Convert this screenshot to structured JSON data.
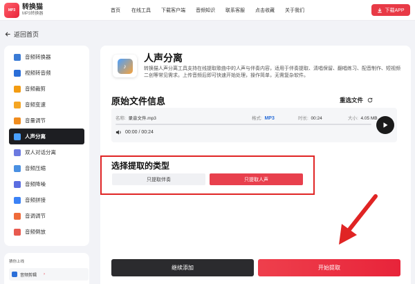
{
  "brand": {
    "logo_text": "MP3",
    "name": "转换猫",
    "subtitle": "MP3转换器"
  },
  "nav": [
    "首页",
    "在线工具",
    "下载客户端",
    "音频知识",
    "联系客服",
    "点击收藏",
    "关于我们"
  ],
  "download_label": "下载APP",
  "back_label": "返回首页",
  "sidebar": {
    "items": [
      {
        "label": "音频转换器",
        "color": "#3a7bd5"
      },
      {
        "label": "视频转音频",
        "color": "#2a6ed8"
      },
      {
        "label": "音频裁剪",
        "color": "#f39c12"
      },
      {
        "label": "音频变速",
        "color": "#f5a623"
      },
      {
        "label": "音量调节",
        "color": "#f08c1e"
      },
      {
        "label": "人声分离",
        "color": "#4aa0ff"
      },
      {
        "label": "双人对话分离",
        "color": "#6c7ae0"
      },
      {
        "label": "音频压缩",
        "color": "#4a90e2"
      },
      {
        "label": "音频降噪",
        "color": "#5b6ee1"
      },
      {
        "label": "音频拼接",
        "color": "#3b82f6"
      },
      {
        "label": "音调调节",
        "color": "#ef6b3a"
      },
      {
        "label": "音频倒放",
        "color": "#e85a4f"
      }
    ],
    "active_index": 5
  },
  "recommend": {
    "title": "猜你上线",
    "item_label": "音频剪辑",
    "arrow": "›"
  },
  "tool": {
    "icon_glyph": "♪",
    "title": "人声分离",
    "description": "转换猫人声分离工具支持在线提取歌曲中的人声与伴奏内容，适用于伴奏提取、清唱保留、翻唱练习、配音制作、短视频二创等常见需求。上传音频后即可快速开始处理，操作简单，无需复杂软件。"
  },
  "original": {
    "title": "原始文件信息",
    "reselect_label": "重选文件",
    "file": {
      "name_label": "名称:",
      "name": "录音文件.mp3",
      "format_label": "格式:",
      "format": "MP3",
      "duration_label": "时长:",
      "duration": "00:24",
      "size_label": "大小:",
      "size": "4.05 MB"
    },
    "current_time": "00:00 / 00:24",
    "progress": 0
  },
  "extract": {
    "title": "选择提取的类型",
    "options": [
      "只提取伴奏",
      "只提取人声"
    ],
    "selected_index": 1
  },
  "actions": {
    "continue_label": "继续添加",
    "start_label": "开始提取"
  },
  "colors": {
    "accent": "#e83a46",
    "highlight_border": "#e02424",
    "active_bg": "#1d1e22",
    "format_blue": "#2a6ed8"
  }
}
